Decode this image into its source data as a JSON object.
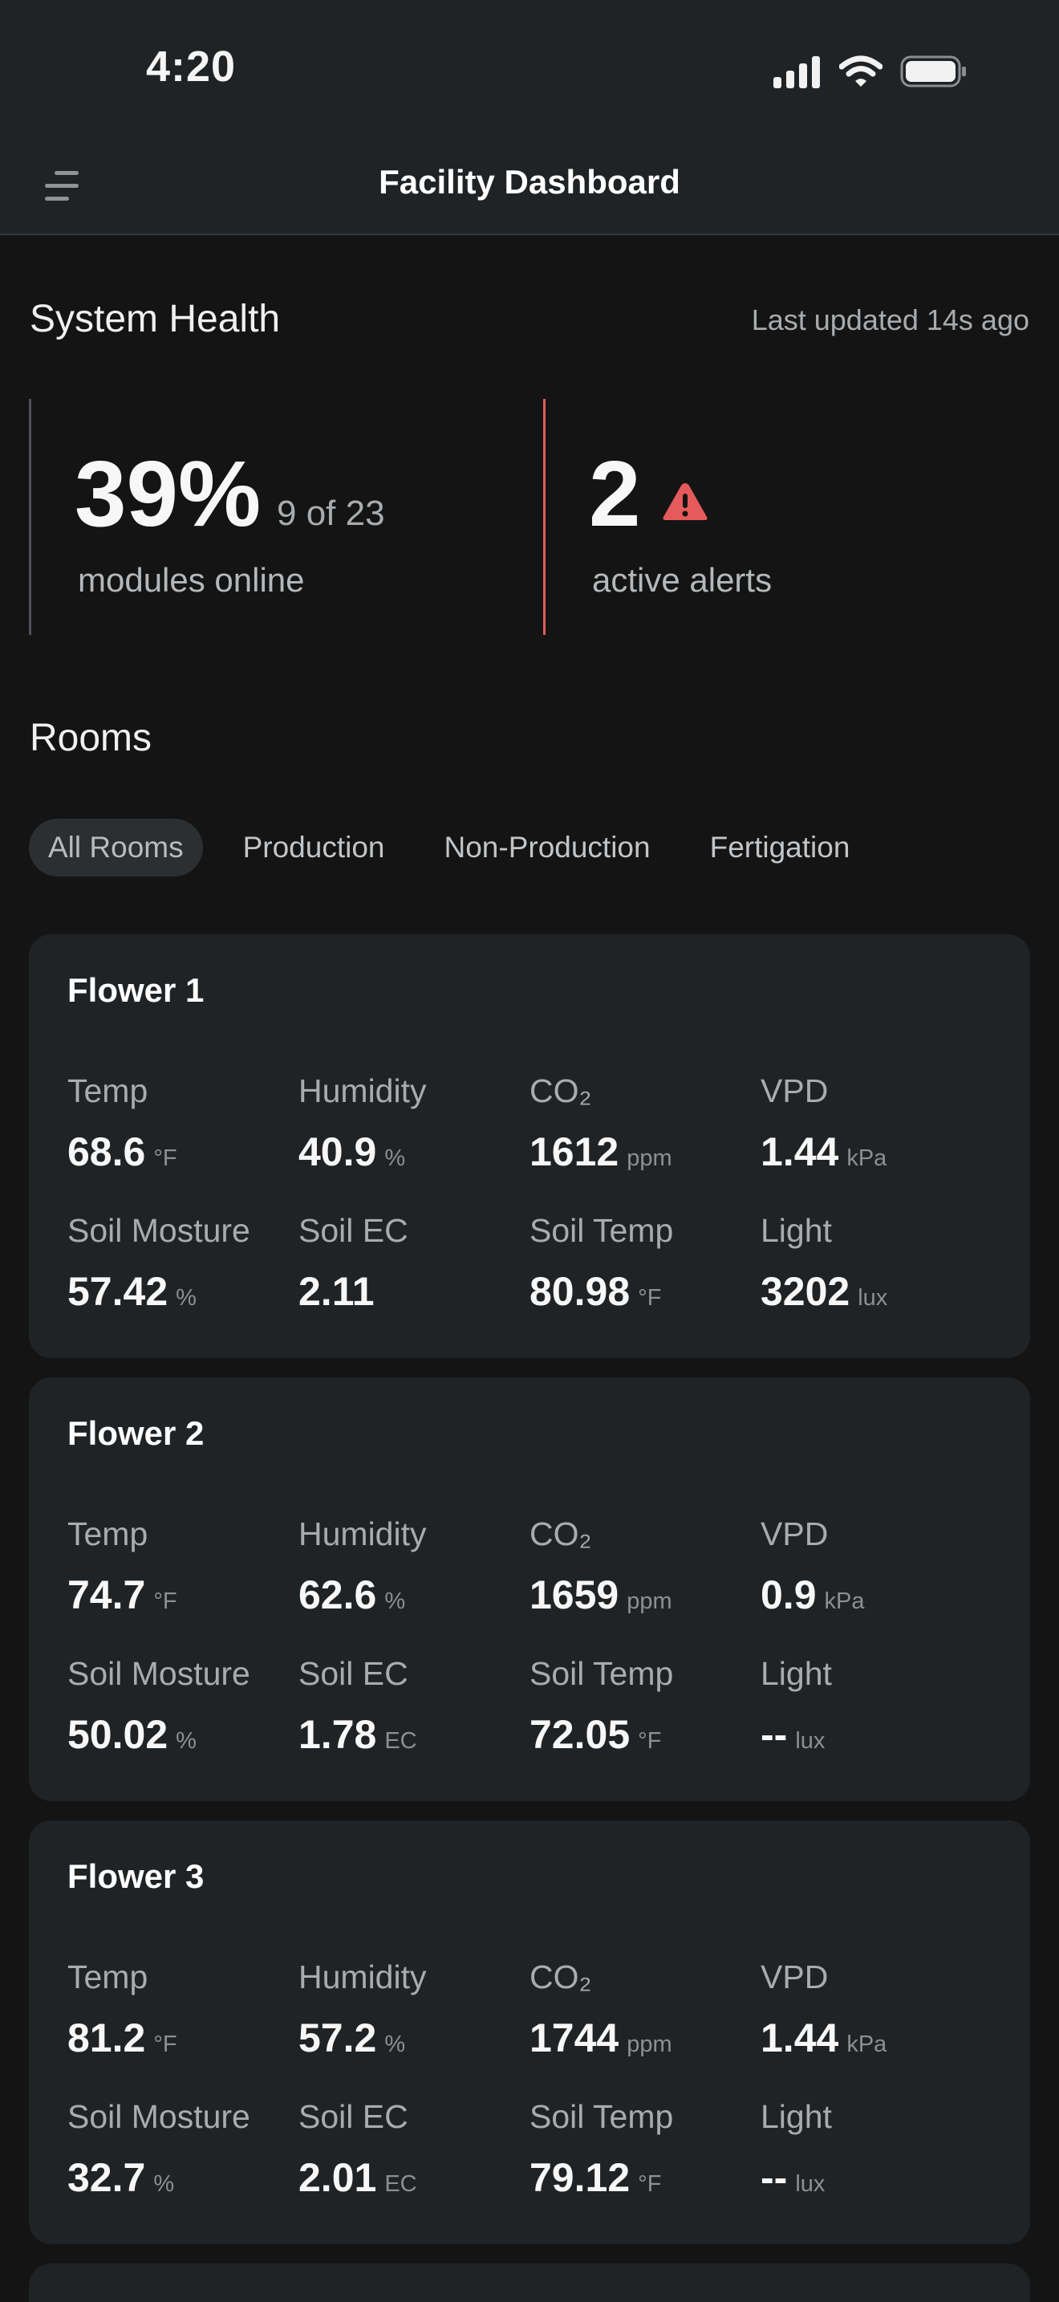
{
  "status_bar": {
    "time": "4:20"
  },
  "header": {
    "title": "Facility Dashboard"
  },
  "system_health": {
    "title": "System Health",
    "last_updated": "Last updated 14s ago",
    "modules": {
      "percent": "39%",
      "count": "9 of 23",
      "caption": "modules online"
    },
    "alerts": {
      "count": "2",
      "caption": "active alerts"
    }
  },
  "rooms": {
    "title": "Rooms",
    "tabs": [
      {
        "label": "All Rooms",
        "active": true
      },
      {
        "label": "Production",
        "active": false
      },
      {
        "label": "Non-Production",
        "active": false
      },
      {
        "label": "Fertigation",
        "active": false
      }
    ],
    "cards": [
      {
        "name": "Flower 1",
        "metrics": [
          {
            "label": "Temp",
            "value": "68.6",
            "unit": "°F"
          },
          {
            "label": "Humidity",
            "value": "40.9",
            "unit": "%"
          },
          {
            "label": "CO₂",
            "value": "1612",
            "unit": "ppm"
          },
          {
            "label": "VPD",
            "value": "1.44",
            "unit": "kPa"
          },
          {
            "label": "Soil Mosture",
            "value": "57.42",
            "unit": "%"
          },
          {
            "label": "Soil EC",
            "value": "2.11",
            "unit": ""
          },
          {
            "label": "Soil Temp",
            "value": "80.98",
            "unit": "°F"
          },
          {
            "label": "Light",
            "value": "3202",
            "unit": "lux"
          }
        ]
      },
      {
        "name": "Flower 2",
        "metrics": [
          {
            "label": "Temp",
            "value": "74.7",
            "unit": "°F"
          },
          {
            "label": "Humidity",
            "value": "62.6",
            "unit": "%"
          },
          {
            "label": "CO₂",
            "value": "1659",
            "unit": "ppm"
          },
          {
            "label": "VPD",
            "value": "0.9",
            "unit": "kPa"
          },
          {
            "label": "Soil Mosture",
            "value": "50.02",
            "unit": "%"
          },
          {
            "label": "Soil EC",
            "value": "1.78",
            "unit": "EC"
          },
          {
            "label": "Soil Temp",
            "value": "72.05",
            "unit": "°F"
          },
          {
            "label": "Light",
            "value": "--",
            "unit": "lux"
          }
        ]
      },
      {
        "name": "Flower 3",
        "metrics": [
          {
            "label": "Temp",
            "value": "81.2",
            "unit": "°F"
          },
          {
            "label": "Humidity",
            "value": "57.2",
            "unit": "%"
          },
          {
            "label": "CO₂",
            "value": "1744",
            "unit": "ppm"
          },
          {
            "label": "VPD",
            "value": "1.44",
            "unit": "kPa"
          },
          {
            "label": "Soil Mosture",
            "value": "32.7",
            "unit": "%"
          },
          {
            "label": "Soil EC",
            "value": "2.01",
            "unit": "EC"
          },
          {
            "label": "Soil Temp",
            "value": "79.12",
            "unit": "°F"
          },
          {
            "label": "Light",
            "value": "--",
            "unit": "lux"
          }
        ]
      }
    ]
  },
  "colors": {
    "background": "#141414",
    "surface": "#202325",
    "alert": "#e55a5a",
    "text_primary": "#f7f7f7",
    "text_secondary": "#a8acaf"
  },
  "icons": [
    "signal-icon",
    "wifi-icon",
    "battery-icon",
    "menu-icon",
    "alert-triangle-icon"
  ]
}
